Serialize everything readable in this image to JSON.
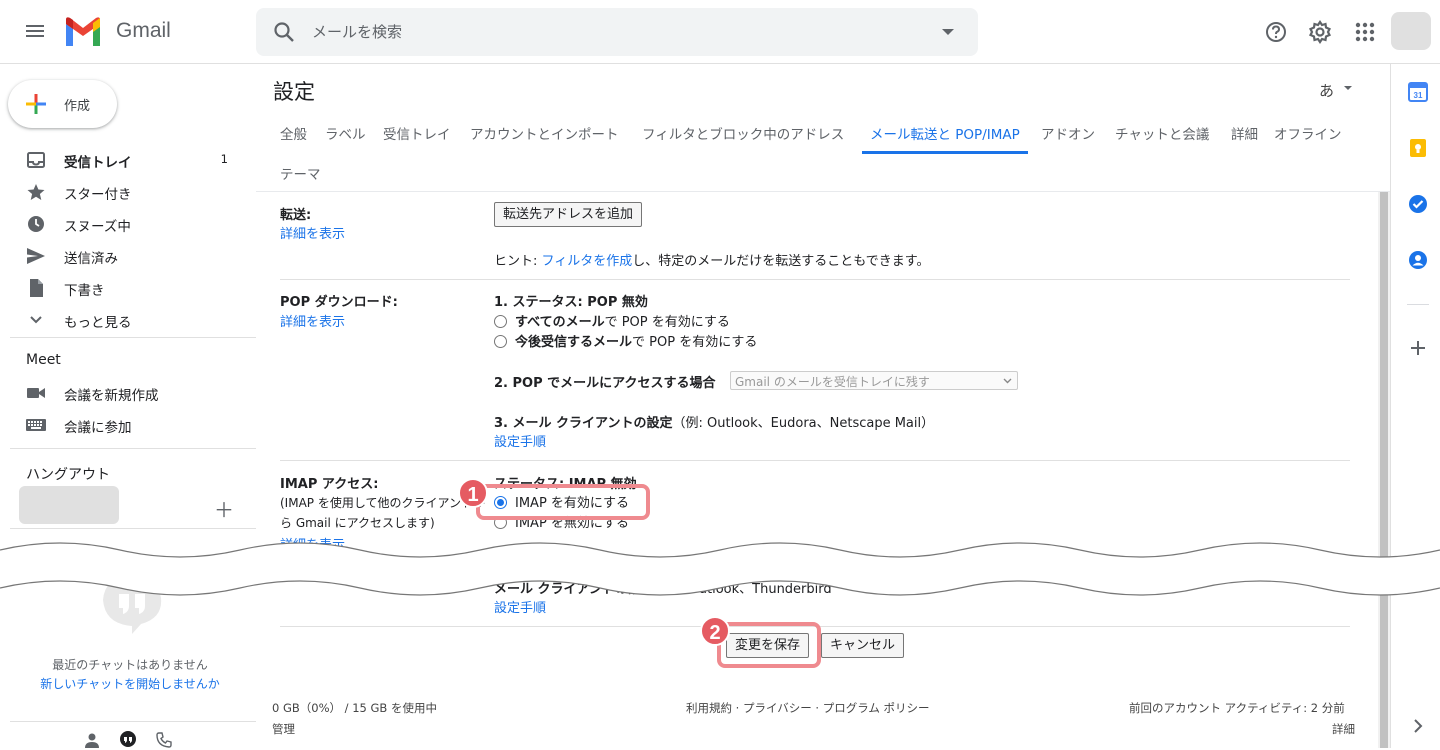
{
  "app": {
    "name": "Gmail"
  },
  "search": {
    "placeholder": "メールを検索"
  },
  "sidebar": {
    "compose_label": "作成",
    "items": [
      {
        "label": "受信トレイ",
        "count": "1",
        "icon": "inbox-icon"
      },
      {
        "label": "スター付き",
        "icon": "star-icon"
      },
      {
        "label": "スヌーズ中",
        "icon": "clock-icon"
      },
      {
        "label": "送信済み",
        "icon": "send-icon"
      },
      {
        "label": "下書き",
        "icon": "draft-icon"
      },
      {
        "label": "もっと見る",
        "icon": "chevron-down-icon"
      }
    ],
    "meet_heading": "Meet",
    "meet_items": [
      {
        "label": "会議を新規作成",
        "icon": "video-icon"
      },
      {
        "label": "会議に参加",
        "icon": "keyboard-icon"
      }
    ],
    "hangout_heading": "ハングアウト",
    "no_chat": "最近のチャットはありません",
    "start_chat": "新しいチャットを開始しませんか"
  },
  "settings": {
    "title": "設定",
    "ime": "あ",
    "tabs": [
      "全般",
      "ラベル",
      "受信トレイ",
      "アカウントとインポート",
      "フィルタとブロック中のアドレス",
      "メール転送と POP/IMAP",
      "アドオン",
      "チャットと会議",
      "詳細",
      "オフライン",
      "テーマ"
    ],
    "active_tab": "メール転送と POP/IMAP",
    "forwarding": {
      "label": "転送:",
      "details_link": "詳細を表示",
      "add_button": "転送先アドレスを追加",
      "hint_prefix": "ヒント: ",
      "hint_link": "フィルタを作成",
      "hint_suffix": "し、特定のメールだけを転送することもできます。"
    },
    "pop": {
      "label": "POP ダウンロード:",
      "details_link": "詳細を表示",
      "status": "1. ステータス: POP 無効",
      "opt_all_bold": "すべてのメール",
      "opt_all_rest": "で POP を有効にする",
      "opt_new_bold": "今後受信するメール",
      "opt_new_rest": "で POP を有効にする",
      "access_label": "2. POP でメールにアクセスする場合",
      "access_select": "Gmail のメールを受信トレイに残す",
      "client_bold": "3. メール クライアントの設定",
      "client_rest": "（例: Outlook、Eudora、Netscape Mail）",
      "setup_link": "設定手順"
    },
    "imap": {
      "label": "IMAP アクセス:",
      "desc_line1": "(IMAP を使用して他のクライアントか",
      "desc_line2": "ら Gmail にアクセスします)",
      "details_link": "詳細を表示",
      "status": "ステータス: IMAP 無効",
      "enable": "IMAP を有効にする",
      "disable": "IMAP を無効にする",
      "client_bold": "メール クライアントの設定",
      "client_rest": "（例: Outlook、Thunderbird",
      "setup_link": "設定手順"
    },
    "save_button": "変更を保存",
    "cancel_button": "キャンセル"
  },
  "callouts": {
    "step1": "1",
    "step2": "2"
  },
  "footer": {
    "storage": "0 GB（0%） / 15 GB を使用中",
    "manage": "管理",
    "links": "利用規約 · プライバシー · プログラム ポリシー",
    "activity": "前回のアカウント アクティビティ: 2 分前",
    "details": "詳細"
  },
  "colors": {
    "accent": "#1a73e8",
    "callout": "#e55b62"
  }
}
